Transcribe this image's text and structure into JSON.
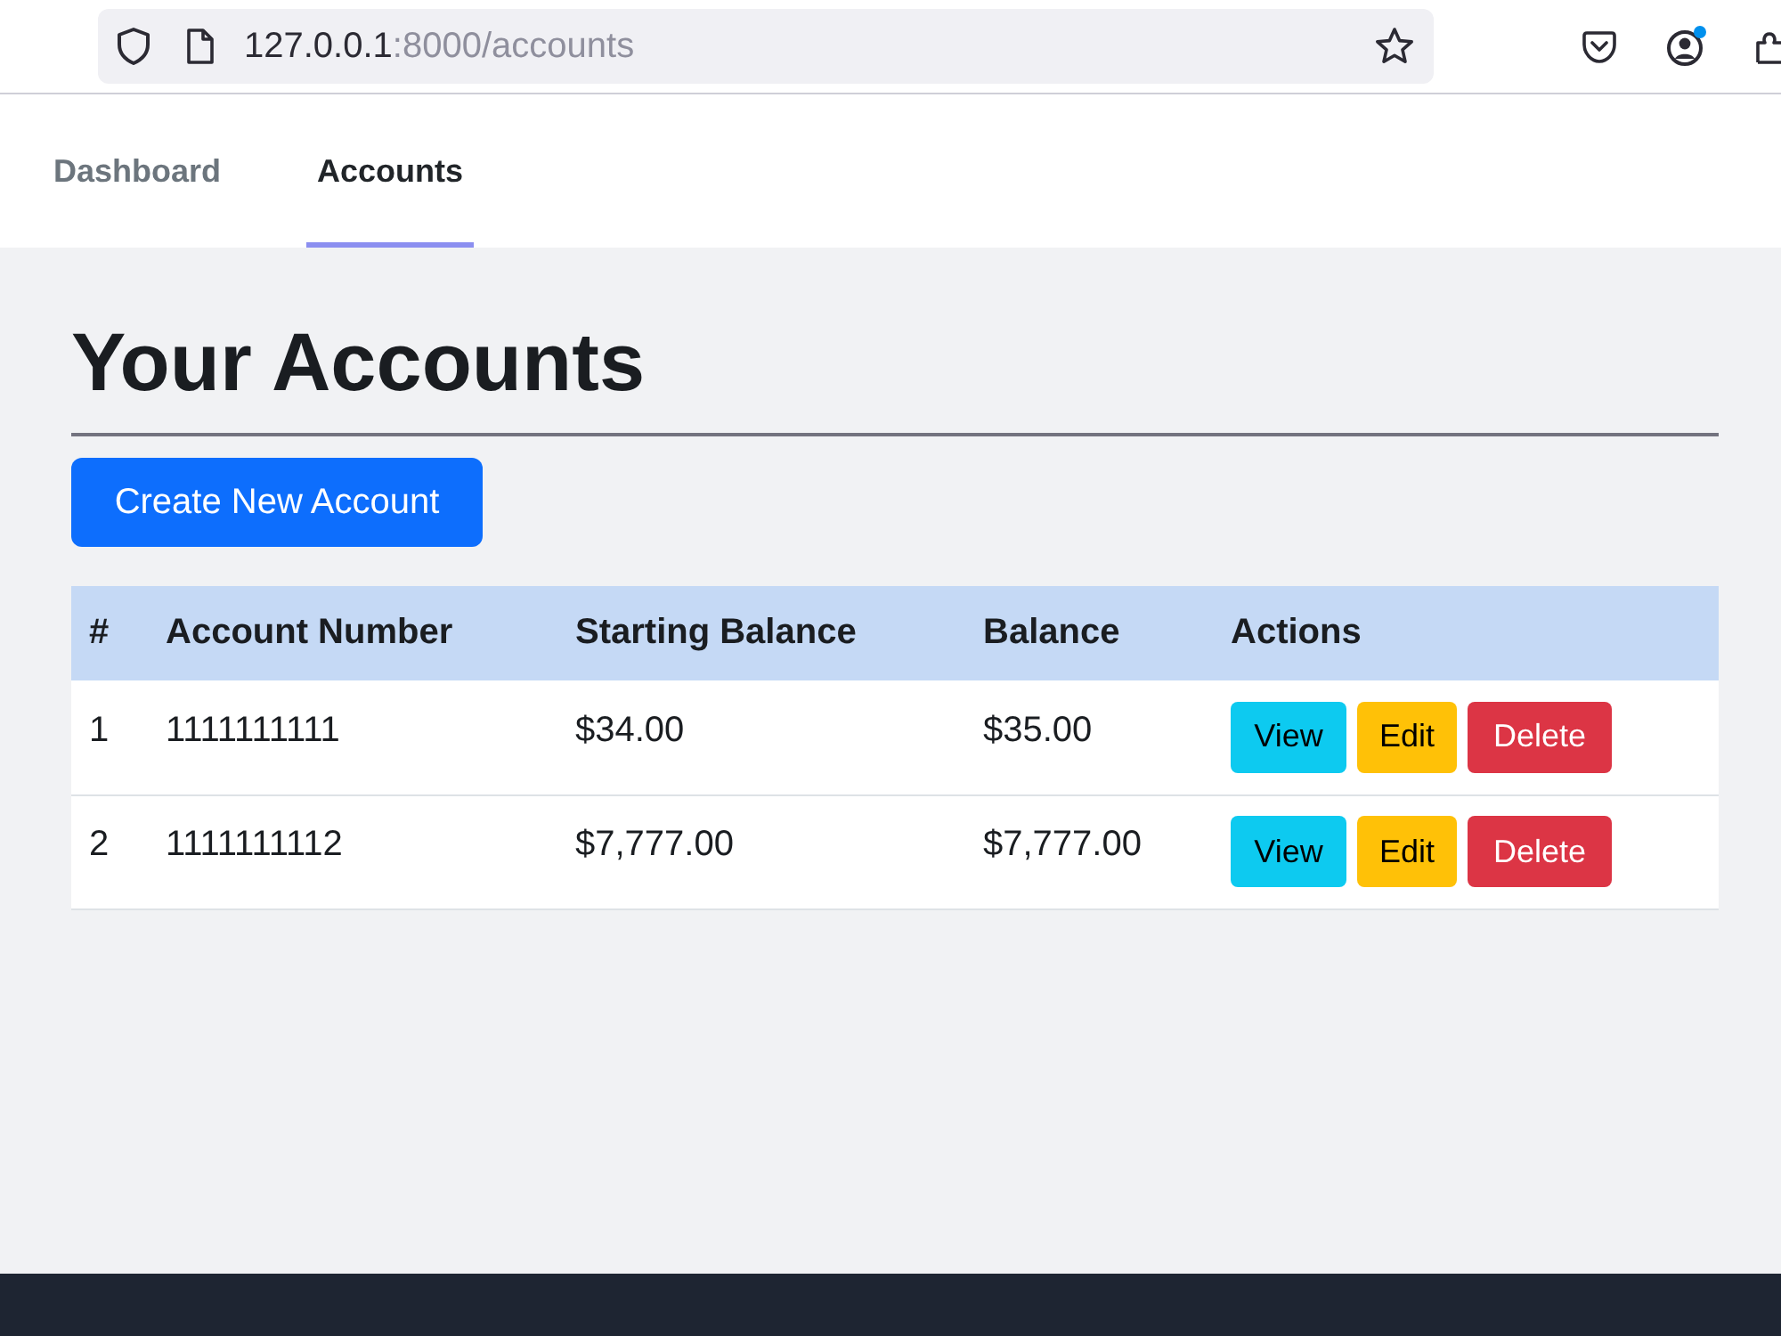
{
  "browser": {
    "url": {
      "host": "127.0.0.1",
      "path": ":8000/accounts"
    }
  },
  "nav": {
    "tabs": [
      {
        "label": "Dashboard",
        "selected": false
      },
      {
        "label": "Accounts",
        "selected": true
      }
    ]
  },
  "page": {
    "title": "Your Accounts",
    "create_button": "Create New Account"
  },
  "table": {
    "columns": [
      "#",
      "Account Number",
      "Starting Balance",
      "Balance",
      "Actions"
    ],
    "rows": [
      {
        "cells": [
          "1",
          "1111111111",
          "$34.00",
          "$35.00"
        ],
        "actions": [
          {
            "label": "View",
            "kind": "view"
          },
          {
            "label": "Edit",
            "kind": "edit"
          },
          {
            "label": "Delete",
            "kind": "delete"
          }
        ]
      },
      {
        "cells": [
          "2",
          "1111111112",
          "$7,777.00",
          "$7,777.00"
        ],
        "actions": [
          {
            "label": "View",
            "kind": "view"
          },
          {
            "label": "Edit",
            "kind": "edit"
          },
          {
            "label": "Delete",
            "kind": "delete"
          }
        ]
      }
    ]
  }
}
